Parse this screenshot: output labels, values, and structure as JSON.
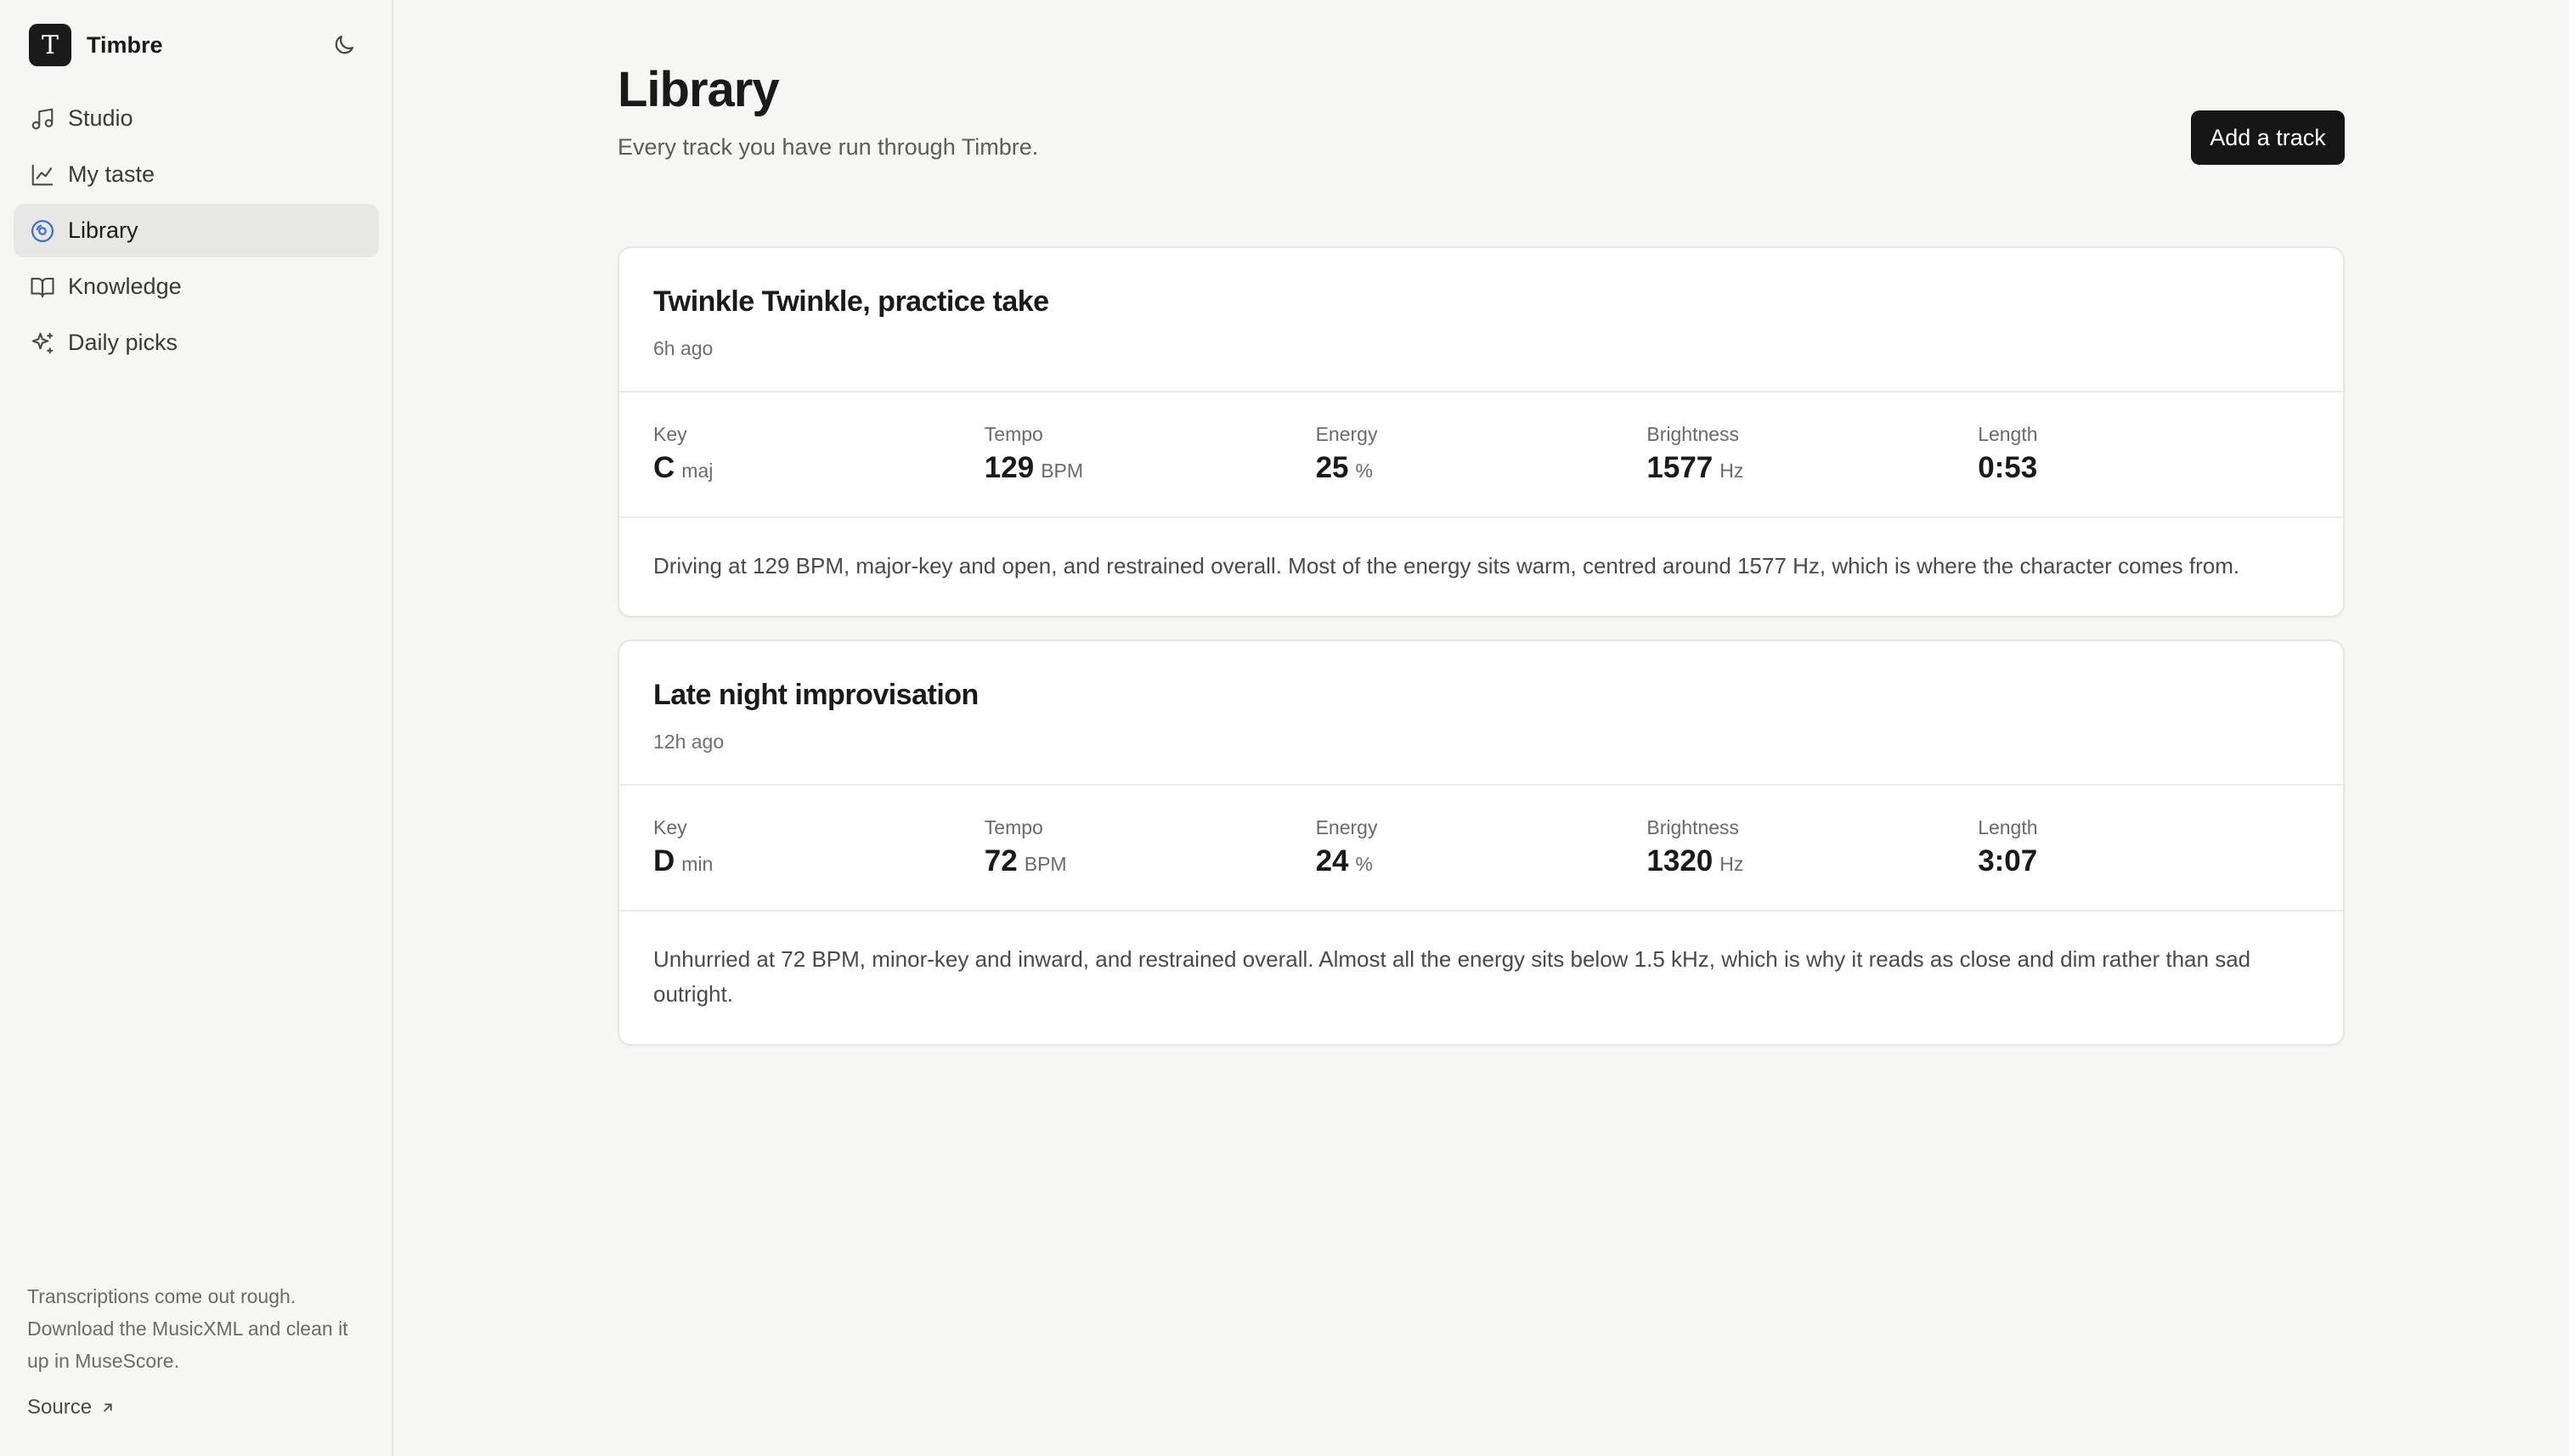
{
  "app": {
    "name": "Timbre",
    "logo_letter": "T",
    "theme_toggle_icon": "moon-icon"
  },
  "sidebar": {
    "items": [
      {
        "label": "Studio",
        "icon": "music-note-icon",
        "active": false
      },
      {
        "label": "My taste",
        "icon": "line-chart-icon",
        "active": false
      },
      {
        "label": "Library",
        "icon": "disc-icon",
        "active": true
      },
      {
        "label": "Knowledge",
        "icon": "book-icon",
        "active": false
      },
      {
        "label": "Daily picks",
        "icon": "sparkle-icon",
        "active": false
      }
    ],
    "footer_note": "Transcriptions come out rough. Download the MusicXML and clean it up in MuseScore.",
    "source_label": "Source",
    "active_color": "#3b6fd4"
  },
  "page": {
    "title": "Library",
    "subtitle": "Every track you have run through Timbre.",
    "add_button_label": "Add a track"
  },
  "tracks": [
    {
      "title": "Twinkle Twinkle, practice take",
      "time": "6h ago",
      "metrics": [
        {
          "label": "Key",
          "value": "C",
          "unit": "maj"
        },
        {
          "label": "Tempo",
          "value": "129",
          "unit": "BPM"
        },
        {
          "label": "Energy",
          "value": "25",
          "unit": "%"
        },
        {
          "label": "Brightness",
          "value": "1577",
          "unit": "Hz"
        },
        {
          "label": "Length",
          "value": "0:53",
          "unit": ""
        }
      ],
      "description": "Driving at 129 BPM, major-key and open, and restrained overall. Most of the energy sits warm, centred around 1577 Hz, which is where the character comes from."
    },
    {
      "title": "Late night improvisation",
      "time": "12h ago",
      "metrics": [
        {
          "label": "Key",
          "value": "D",
          "unit": "min"
        },
        {
          "label": "Tempo",
          "value": "72",
          "unit": "BPM"
        },
        {
          "label": "Energy",
          "value": "24",
          "unit": "%"
        },
        {
          "label": "Brightness",
          "value": "1320",
          "unit": "Hz"
        },
        {
          "label": "Length",
          "value": "3:07",
          "unit": ""
        }
      ],
      "description": "Unhurried at 72 BPM, minor-key and inward, and restrained overall. Almost all the energy sits below 1.5 kHz, which is why it reads as close and dim rather than sad outright."
    }
  ]
}
